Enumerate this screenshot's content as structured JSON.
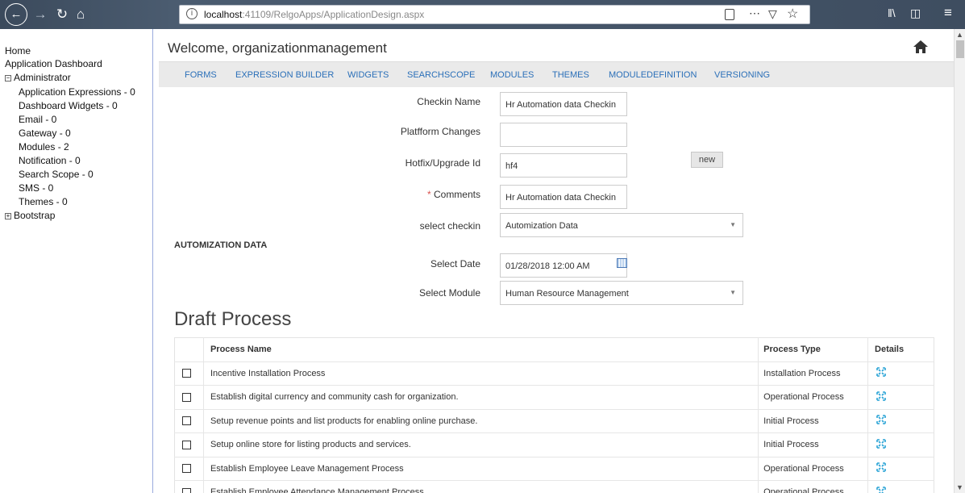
{
  "browser": {
    "url_host": "localhost",
    "url_rest": ":41109/RelgoApps/ApplicationDesign.aspx"
  },
  "tree": {
    "home": "Home",
    "dashboard": "Application Dashboard",
    "administrator": "Administrator",
    "admin_items": [
      "Application Expressions - 0",
      "Dashboard Widgets - 0",
      "Email - 0",
      "Gateway - 0",
      "Modules - 2",
      "Notification - 0",
      "Search Scope - 0",
      "SMS - 0",
      "Themes - 0"
    ],
    "bootstrap": "Bootstrap"
  },
  "header": {
    "welcome": "Welcome, organizationmanagement"
  },
  "menu": [
    "FORMS",
    "EXPRESSION BUILDER",
    "WIDGETS",
    "SEARCHSCOPE",
    "MODULES",
    "THEMES",
    "MODULEDEFINITION",
    "VERSIONING"
  ],
  "form": {
    "checkin_name_label": "Checkin Name",
    "checkin_name_value": "Hr Automation data Checkin",
    "platform_label": "Platfform Changes",
    "platform_value": "",
    "hotfix_label": "Hotfix/Upgrade Id",
    "hotfix_value": "hf4",
    "new_button": "new",
    "comments_req": "*",
    "comments_label": " Comments",
    "comments_value": "Hr Automation data Checkin",
    "select_checkin_label": "select checkin",
    "select_checkin_value": "Automization Data",
    "section_title": "AUTOMIZATION DATA",
    "date_label": "Select Date",
    "date_value": "01/28/2018 12:00 AM",
    "module_label": "Select Module",
    "module_value": "Human Resource Management"
  },
  "draft": {
    "title": "Draft Process",
    "headers": {
      "name": "Process Name",
      "type": "Process Type",
      "details": "Details"
    },
    "rows": [
      {
        "name": "Incentive Installation Process",
        "type": "Installation Process"
      },
      {
        "name": "Establish digital currency and community cash for organization.",
        "type": "Operational Process"
      },
      {
        "name": "Setup revenue points and list products for enabling online purchase.",
        "type": "Initial Process"
      },
      {
        "name": "Setup online store for listing products and services.",
        "type": "Initial Process"
      },
      {
        "name": "Establish Employee Leave Management Process",
        "type": "Operational Process"
      },
      {
        "name": "Establish Employee Attendance Management Process",
        "type": "Operational Process"
      }
    ]
  },
  "colors": {
    "accent": "#2a6fb8",
    "expand_icon": "#29a3d6",
    "required": "#d9534f"
  }
}
